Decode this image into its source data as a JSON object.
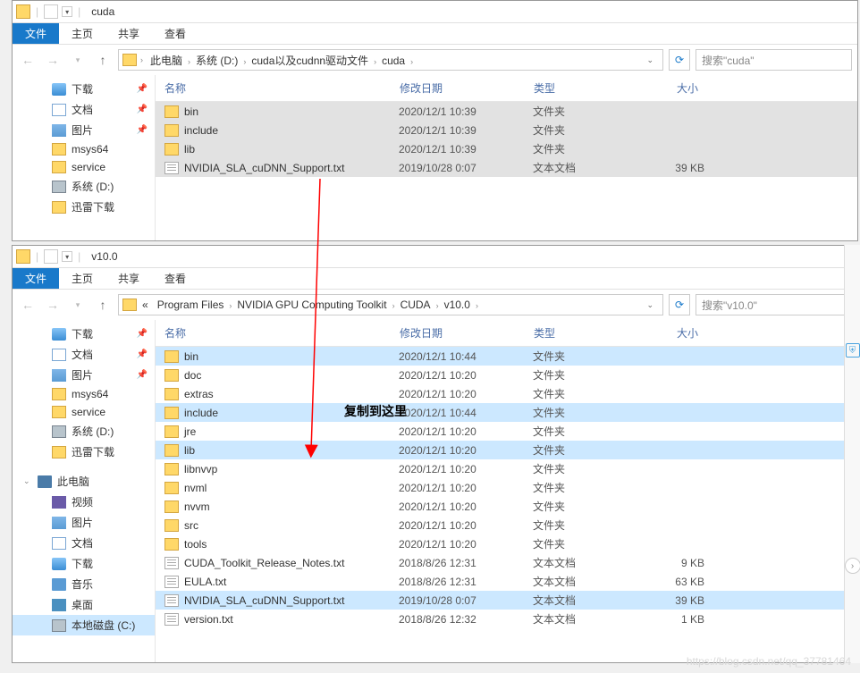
{
  "win1": {
    "title": "cuda",
    "ribbon": {
      "file": "文件",
      "home": "主页",
      "share": "共享",
      "view": "查看"
    },
    "breadcrumb": [
      "此电脑",
      "系统 (D:)",
      "cuda以及cudnn驱动文件",
      "cuda"
    ],
    "search_placeholder": "搜索\"cuda\"",
    "columns": {
      "name": "名称",
      "date": "修改日期",
      "type": "类型",
      "size": "大小"
    },
    "sidebar": [
      {
        "label": "下载",
        "icon": "dl",
        "pin": true
      },
      {
        "label": "文档",
        "icon": "doc",
        "pin": true
      },
      {
        "label": "图片",
        "icon": "pic",
        "pin": true
      },
      {
        "label": "msys64",
        "icon": "folder"
      },
      {
        "label": "service",
        "icon": "folder"
      },
      {
        "label": "系统 (D:)",
        "icon": "drive"
      },
      {
        "label": "迅雷下载",
        "icon": "folder"
      }
    ],
    "rows": [
      {
        "name": "bin",
        "date": "2020/12/1 10:39",
        "type": "文件夹",
        "size": "",
        "icon": "folder",
        "sel": true
      },
      {
        "name": "include",
        "date": "2020/12/1 10:39",
        "type": "文件夹",
        "size": "",
        "icon": "folder",
        "sel": true
      },
      {
        "name": "lib",
        "date": "2020/12/1 10:39",
        "type": "文件夹",
        "size": "",
        "icon": "folder",
        "sel": true
      },
      {
        "name": "NVIDIA_SLA_cuDNN_Support.txt",
        "date": "2019/10/28 0:07",
        "type": "文本文档",
        "size": "39 KB",
        "icon": "txt",
        "sel": true
      }
    ]
  },
  "win2": {
    "title": "v10.0",
    "ribbon": {
      "file": "文件",
      "home": "主页",
      "share": "共享",
      "view": "查看"
    },
    "breadcrumb": [
      "Program Files",
      "NVIDIA GPU Computing Toolkit",
      "CUDA",
      "v10.0"
    ],
    "breadcrumb_prefix": "«",
    "search_placeholder": "搜索\"v10.0\"",
    "columns": {
      "name": "名称",
      "date": "修改日期",
      "type": "类型",
      "size": "大小"
    },
    "sidebar_top": [
      {
        "label": "下载",
        "icon": "dl",
        "pin": true
      },
      {
        "label": "文档",
        "icon": "doc",
        "pin": true
      },
      {
        "label": "图片",
        "icon": "pic",
        "pin": true
      },
      {
        "label": "msys64",
        "icon": "folder"
      },
      {
        "label": "service",
        "icon": "folder"
      },
      {
        "label": "系统 (D:)",
        "icon": "drive"
      },
      {
        "label": "迅雷下载",
        "icon": "folder"
      }
    ],
    "sidebar_pc_label": "此电脑",
    "sidebar_pc": [
      {
        "label": "视频",
        "icon": "video"
      },
      {
        "label": "图片",
        "icon": "pic"
      },
      {
        "label": "文档",
        "icon": "doc"
      },
      {
        "label": "下载",
        "icon": "dl"
      },
      {
        "label": "音乐",
        "icon": "music"
      },
      {
        "label": "桌面",
        "icon": "desktop"
      },
      {
        "label": "本地磁盘 (C:)",
        "icon": "drive",
        "sel": true
      }
    ],
    "rows": [
      {
        "name": "bin",
        "date": "2020/12/1 10:44",
        "type": "文件夹",
        "size": "",
        "icon": "folder",
        "hl": true
      },
      {
        "name": "doc",
        "date": "2020/12/1 10:20",
        "type": "文件夹",
        "size": "",
        "icon": "folder"
      },
      {
        "name": "extras",
        "date": "2020/12/1 10:20",
        "type": "文件夹",
        "size": "",
        "icon": "folder"
      },
      {
        "name": "include",
        "date": "2020/12/1 10:44",
        "type": "文件夹",
        "size": "",
        "icon": "folder",
        "hl": true
      },
      {
        "name": "jre",
        "date": "2020/12/1 10:20",
        "type": "文件夹",
        "size": "",
        "icon": "folder"
      },
      {
        "name": "lib",
        "date": "2020/12/1 10:20",
        "type": "文件夹",
        "size": "",
        "icon": "folder",
        "hl": true
      },
      {
        "name": "libnvvp",
        "date": "2020/12/1 10:20",
        "type": "文件夹",
        "size": "",
        "icon": "folder"
      },
      {
        "name": "nvml",
        "date": "2020/12/1 10:20",
        "type": "文件夹",
        "size": "",
        "icon": "folder"
      },
      {
        "name": "nvvm",
        "date": "2020/12/1 10:20",
        "type": "文件夹",
        "size": "",
        "icon": "folder"
      },
      {
        "name": "src",
        "date": "2020/12/1 10:20",
        "type": "文件夹",
        "size": "",
        "icon": "folder"
      },
      {
        "name": "tools",
        "date": "2020/12/1 10:20",
        "type": "文件夹",
        "size": "",
        "icon": "folder"
      },
      {
        "name": "CUDA_Toolkit_Release_Notes.txt",
        "date": "2018/8/26 12:31",
        "type": "文本文档",
        "size": "9 KB",
        "icon": "txt"
      },
      {
        "name": "EULA.txt",
        "date": "2018/8/26 12:31",
        "type": "文本文档",
        "size": "63 KB",
        "icon": "txt"
      },
      {
        "name": "NVIDIA_SLA_cuDNN_Support.txt",
        "date": "2019/10/28 0:07",
        "type": "文本文档",
        "size": "39 KB",
        "icon": "txt",
        "hl": true
      },
      {
        "name": "version.txt",
        "date": "2018/8/26 12:32",
        "type": "文本文档",
        "size": "1 KB",
        "icon": "txt"
      }
    ]
  },
  "annotation": "复制到这里",
  "watermark": "https://blog.csdn.net/qq_37781464"
}
